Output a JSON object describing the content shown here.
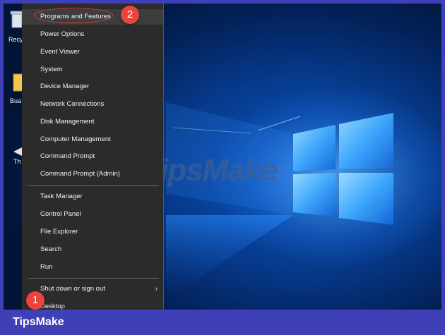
{
  "menu": {
    "items": [
      {
        "label": "Programs and Features"
      },
      {
        "label": "Power Options"
      },
      {
        "label": "Event Viewer"
      },
      {
        "label": "System"
      },
      {
        "label": "Device Manager"
      },
      {
        "label": "Network Connections"
      },
      {
        "label": "Disk Management"
      },
      {
        "label": "Computer Management"
      },
      {
        "label": "Command Prompt"
      },
      {
        "label": "Command Prompt (Admin)"
      },
      {
        "label": "Task Manager"
      },
      {
        "label": "Control Panel"
      },
      {
        "label": "File Explorer"
      },
      {
        "label": "Search"
      },
      {
        "label": "Run"
      },
      {
        "label": "Shut down or sign out"
      },
      {
        "label": "Desktop"
      }
    ]
  },
  "desktop": {
    "icons": [
      {
        "label": "Recy"
      },
      {
        "label": "Bua"
      },
      {
        "label": "Th"
      }
    ]
  },
  "annotations": {
    "step1": "1",
    "step2": "2"
  },
  "watermark": "TipsMake",
  "footer": {
    "brand": "TipsMake"
  },
  "colors": {
    "frame": "#3f3fb8",
    "menu_bg": "#2b2b2b",
    "badge": "#e8463c",
    "highlight_ring": "#e03a3a"
  }
}
